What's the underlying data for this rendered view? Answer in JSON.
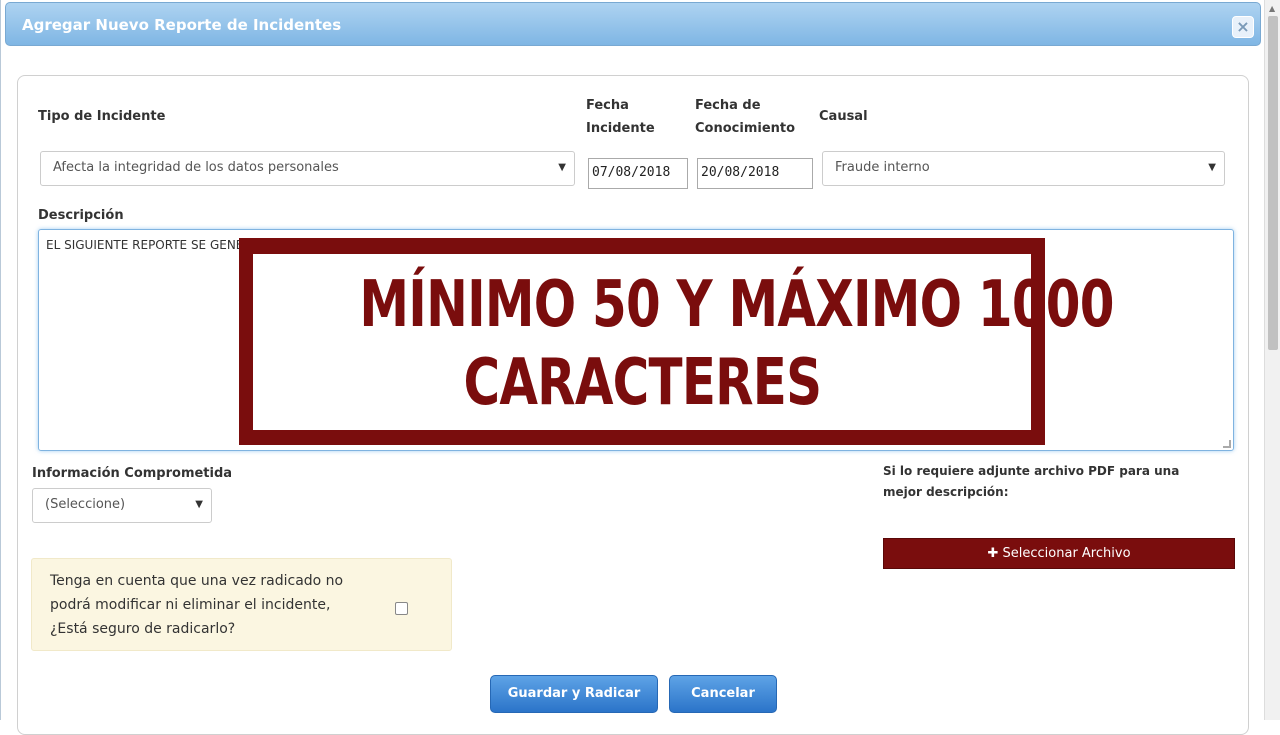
{
  "dialog": {
    "title": "Agregar Nuevo Reporte de Incidentes",
    "close_label": "×"
  },
  "form": {
    "tipo_incidente_label": "Tipo de Incidente",
    "tipo_incidente_value": "Afecta la integridad de los datos personales",
    "fecha_incidente_label_1": "Fecha",
    "fecha_incidente_label_2": "Incidente",
    "fecha_incidente_value": "07/08/2018",
    "fecha_conocimiento_label_1": "Fecha de",
    "fecha_conocimiento_label_2": "Conocimiento",
    "fecha_conocimiento_value": "20/08/2018",
    "causal_label": "Causal",
    "causal_value": "Fraude interno",
    "descripcion_label": "Descripción",
    "descripcion_value": "EL SIGUIENTE REPORTE SE GENE",
    "info_comprometida_label": "Información Comprometida",
    "info_comprometida_value": "(Seleccione)",
    "pdf_hint": "Si lo requiere adjunte archivo PDF para una mejor descripción:",
    "file_button_label": "Seleccionar Archivo",
    "warning_text": "Tenga en cuenta que una vez radicado no podrá modificar ni eliminar el incidente, ¿Está seguro de radicarlo?",
    "save_button_label": "Guardar y Radicar",
    "cancel_button_label": "Cancelar"
  },
  "overlay": {
    "line1": "MÍNIMO 50 Y MÁXIMO 1000",
    "line2": "CARACTERES"
  },
  "colors": {
    "accent_red": "#7a0d0d",
    "primary_blue": "#2b74c9",
    "title_blue": "#7fb6e4"
  }
}
